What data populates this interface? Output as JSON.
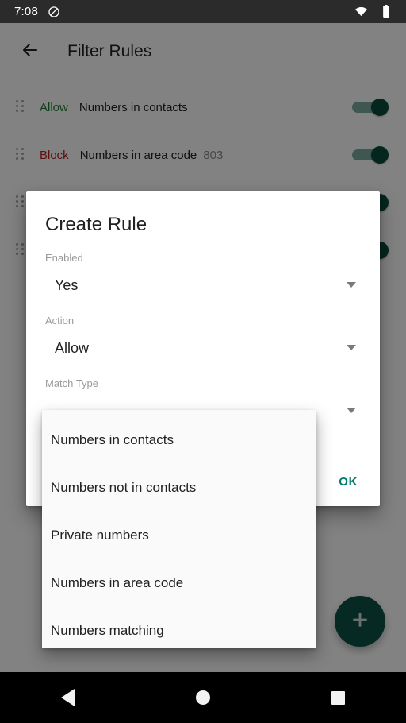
{
  "status_bar": {
    "time": "7:08",
    "left_icons": [
      "do-not-disturb-icon"
    ],
    "right_icons": [
      "wifi-icon",
      "battery-icon"
    ]
  },
  "appbar": {
    "back_label": "back-arrow",
    "title": "Filter Rules"
  },
  "rules": [
    {
      "action": "Allow",
      "action_color": "#1b7a2e",
      "description": "Numbers in contacts",
      "param": "",
      "enabled": true
    },
    {
      "action": "Block",
      "action_color": "#b0201f",
      "description": "Numbers in area code",
      "param": "803",
      "enabled": true
    },
    {
      "action": "",
      "action_color": "#1b7a2e",
      "description": "",
      "param": "",
      "enabled": true
    },
    {
      "action": "",
      "action_color": "#1b7a2e",
      "description": "",
      "param": "",
      "enabled": true
    }
  ],
  "fab": {
    "icon": "plus-icon",
    "color": "#0d5043"
  },
  "dialog": {
    "title": "Create Rule",
    "fields": [
      {
        "label": "Enabled",
        "value": "Yes"
      },
      {
        "label": "Action",
        "value": "Allow"
      },
      {
        "label": "Match Type",
        "value": ""
      }
    ],
    "ok_label": "OK",
    "accent_color": "#00796b"
  },
  "dropdown": {
    "items": [
      "Numbers in contacts",
      "Numbers not in contacts",
      "Private numbers",
      "Numbers in area code",
      "Numbers matching"
    ]
  },
  "nav_bar": {
    "back": "back-triangle-icon",
    "home": "home-circle-icon",
    "recents": "recents-square-icon"
  }
}
